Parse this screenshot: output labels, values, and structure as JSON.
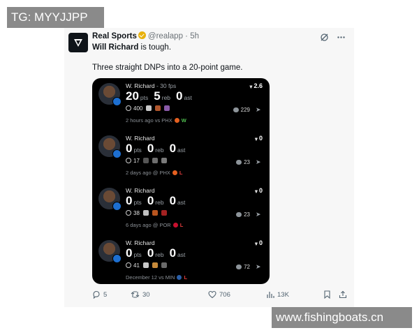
{
  "watermarks": {
    "top": "TG: MYYJJPP",
    "bottom": "www.fishingboats.cn"
  },
  "tweet": {
    "author": {
      "name": "Real Sports",
      "handle": "@realapp",
      "time": "5h",
      "separator": "·"
    },
    "text_bold": "Will Richard",
    "text_rest": " is tough.",
    "text2": "Three straight DNPs into a 20-point game.",
    "icons": [
      "grok-icon",
      "more-icon"
    ]
  },
  "card": {
    "rows": [
      {
        "player": "W. Richard",
        "subtitle": " - 30 fps",
        "pts": "20",
        "reb": "5",
        "ast": "0",
        "pts_label": "pts",
        "reb_label": "reb",
        "ast_label": "ast",
        "views": "400",
        "comments": "229",
        "score": "2.6",
        "when": "2 hours ago vs PHX",
        "result": "W",
        "result_color": "#4fbf4f",
        "team_color": "#e56020",
        "emoji_colors": [
          "#c9c9c9",
          "#b0562d",
          "#8a5aa8"
        ]
      },
      {
        "player": "W. Richard",
        "subtitle": "",
        "pts": "0",
        "reb": "0",
        "ast": "0",
        "pts_label": "pts",
        "reb_label": "reb",
        "ast_label": "ast",
        "views": "17",
        "comments": "23",
        "score": "0",
        "when": "2 days ago @ PHX",
        "result": "L",
        "result_color": "#e03c3c",
        "team_color": "#e56020",
        "emoji_colors": [
          "#555555",
          "#6d6d6d",
          "#7a7a7a"
        ]
      },
      {
        "player": "W. Richard",
        "subtitle": "",
        "pts": "0",
        "reb": "0",
        "ast": "0",
        "pts_label": "pts",
        "reb_label": "reb",
        "ast_label": "ast",
        "views": "38",
        "comments": "23",
        "score": "0",
        "when": "6 days ago @ POR",
        "result": "L",
        "result_color": "#e03c3c",
        "team_color": "#c8102e",
        "emoji_colors": [
          "#bfbfbf",
          "#b8551f",
          "#a32222"
        ]
      },
      {
        "player": "W. Richard",
        "subtitle": "",
        "pts": "0",
        "reb": "0",
        "ast": "0",
        "pts_label": "pts",
        "reb_label": "reb",
        "ast_label": "ast",
        "views": "41",
        "comments": "72",
        "score": "0",
        "when": "December 12 vs MIN",
        "result": "L",
        "result_color": "#e03c3c",
        "team_color": "#2a5fa8",
        "emoji_colors": [
          "#c8c8c8",
          "#c78a3a",
          "#6a6a6a"
        ]
      }
    ]
  },
  "actions": {
    "replies": "5",
    "reposts": "30",
    "likes": "706",
    "views": "13K"
  }
}
